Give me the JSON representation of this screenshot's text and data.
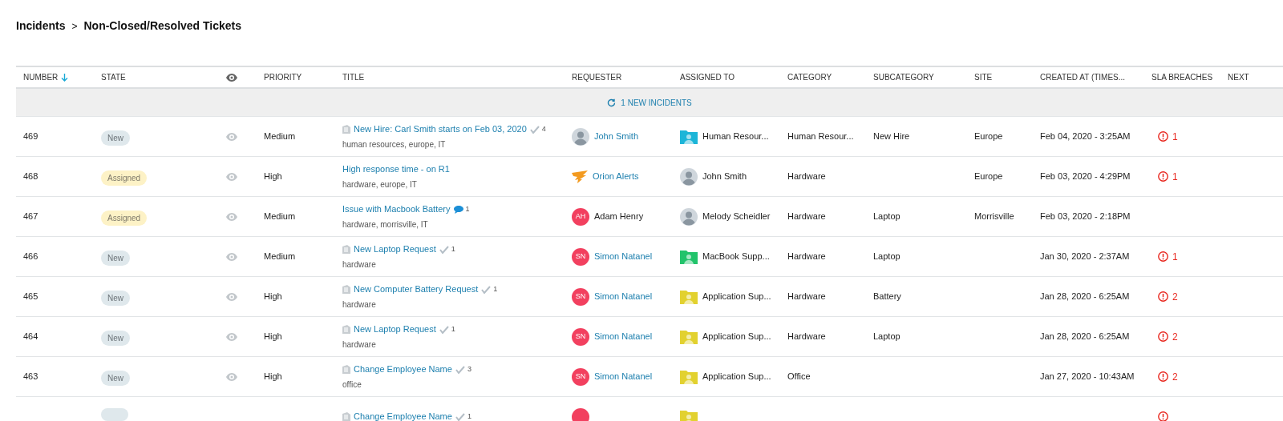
{
  "breadcrumb": {
    "parent": "Incidents",
    "separator": ">",
    "current": "Non-Closed/Resolved Tickets"
  },
  "table": {
    "columns": [
      {
        "label": "NUMBER",
        "sorted": true
      },
      {
        "label": "STATE",
        "sorted": false
      },
      {
        "kind": "eye"
      },
      {
        "label": "PRIORITY",
        "sorted": false
      },
      {
        "label": "TITLE",
        "sorted": false
      },
      {
        "label": "REQUESTER",
        "sorted": false
      },
      {
        "label": "ASSIGNED TO",
        "sorted": false
      },
      {
        "label": "CATEGORY",
        "sorted": false
      },
      {
        "label": "SUBCATEGORY",
        "sorted": false
      },
      {
        "label": "SITE",
        "sorted": false
      },
      {
        "label": "CREATED AT (TIMES...",
        "sorted": false
      },
      {
        "label": "SLA BREACHES",
        "sorted": false
      },
      {
        "label": "NEXT",
        "sorted": false
      }
    ],
    "banner": "1 NEW INCIDENTS",
    "rows": [
      {
        "number": "469",
        "state": {
          "label": "New",
          "kind": "new"
        },
        "priority": "Medium",
        "title": {
          "text": "New Hire: Carl Smith starts on Feb 03, 2020",
          "document": true,
          "badge": {
            "kind": "approval",
            "count": "4"
          },
          "tags": "human resources, europe, IT"
        },
        "requester": {
          "kind": "photo",
          "name": "John Smith",
          "link": true
        },
        "assigned": {
          "kind": "folder",
          "color": "#1cb5d8",
          "name": "Human Resour..."
        },
        "category": "Human Resour...",
        "subcategory": "New Hire",
        "site": "Europe",
        "created": "Feb 04, 2020 - 3:25AM",
        "sla": "1"
      },
      {
        "number": "468",
        "state": {
          "label": "Assigned",
          "kind": "assigned"
        },
        "priority": "High",
        "title": {
          "text": "High response time - on R1",
          "document": false,
          "tags": "hardware, europe, IT"
        },
        "requester": {
          "kind": "logo",
          "name": "Orion Alerts",
          "link": true
        },
        "assigned": {
          "kind": "photo",
          "name": "John Smith"
        },
        "category": "Hardware",
        "site": "Europe",
        "created": "Feb 03, 2020 - 4:29PM",
        "sla": "1"
      },
      {
        "number": "467",
        "state": {
          "label": "Assigned",
          "kind": "assigned"
        },
        "priority": "Medium",
        "title": {
          "text": "Issue with Macbook Battery",
          "document": false,
          "badge": {
            "kind": "comment",
            "count": "1"
          },
          "tags": "hardware, morrisville, IT"
        },
        "requester": {
          "kind": "initials",
          "initials": "AH",
          "name": "Adam Henry",
          "link": false
        },
        "assigned": {
          "kind": "photo",
          "name": "Melody Scheidler"
        },
        "category": "Hardware",
        "subcategory": "Laptop",
        "site": "Morrisville",
        "created": "Feb 03, 2020 - 2:18PM"
      },
      {
        "number": "466",
        "state": {
          "label": "New",
          "kind": "new"
        },
        "priority": "Medium",
        "title": {
          "text": "New Laptop Request",
          "document": true,
          "badge": {
            "kind": "approval",
            "count": "1"
          },
          "tags": "hardware"
        },
        "requester": {
          "kind": "initials",
          "initials": "SN",
          "name": "Simon Natanel",
          "link": true
        },
        "assigned": {
          "kind": "folder",
          "color": "#22c36b",
          "name": "MacBook Supp..."
        },
        "category": "Hardware",
        "subcategory": "Laptop",
        "created": "Jan 30, 2020 - 2:37AM",
        "sla": "1"
      },
      {
        "number": "465",
        "state": {
          "label": "New",
          "kind": "new"
        },
        "priority": "High",
        "title": {
          "text": "New Computer Battery Request",
          "document": true,
          "badge": {
            "kind": "approval",
            "count": "1"
          },
          "tags": "hardware"
        },
        "requester": {
          "kind": "initials",
          "initials": "SN",
          "name": "Simon Natanel",
          "link": true
        },
        "assigned": {
          "kind": "folder",
          "color": "#e2d12f",
          "name": "Application Sup..."
        },
        "category": "Hardware",
        "subcategory": "Battery",
        "created": "Jan 28, 2020 - 6:25AM",
        "sla": "2"
      },
      {
        "number": "464",
        "state": {
          "label": "New",
          "kind": "new"
        },
        "priority": "High",
        "title": {
          "text": "New Laptop Request",
          "document": true,
          "badge": {
            "kind": "approval",
            "count": "1"
          },
          "tags": "hardware"
        },
        "requester": {
          "kind": "initials",
          "initials": "SN",
          "name": "Simon Natanel",
          "link": true
        },
        "assigned": {
          "kind": "folder",
          "color": "#e2d12f",
          "name": "Application Sup..."
        },
        "category": "Hardware",
        "subcategory": "Laptop",
        "created": "Jan 28, 2020 - 6:25AM",
        "sla": "2"
      },
      {
        "number": "463",
        "state": {
          "label": "New",
          "kind": "new"
        },
        "priority": "High",
        "title": {
          "text": "Change Employee Name",
          "document": true,
          "badge": {
            "kind": "approval",
            "count": "3"
          },
          "tags": "office"
        },
        "requester": {
          "kind": "initials",
          "initials": "SN",
          "name": "Simon Natanel",
          "link": true
        },
        "assigned": {
          "kind": "folder",
          "color": "#e2d12f",
          "name": "Application Sup..."
        },
        "category": "Office",
        "created": "Jan 27, 2020 - 10:43AM",
        "sla": "2"
      },
      {
        "state": {
          "kind": "new"
        },
        "title": {
          "text": "Change Employee Name",
          "document": true,
          "badge": {
            "kind": "approval",
            "count": "1"
          }
        },
        "requester": {
          "kind": "initials"
        },
        "assigned": {
          "kind": "folder",
          "color": "#e2d12f"
        },
        "sla_icon": true
      }
    ]
  }
}
